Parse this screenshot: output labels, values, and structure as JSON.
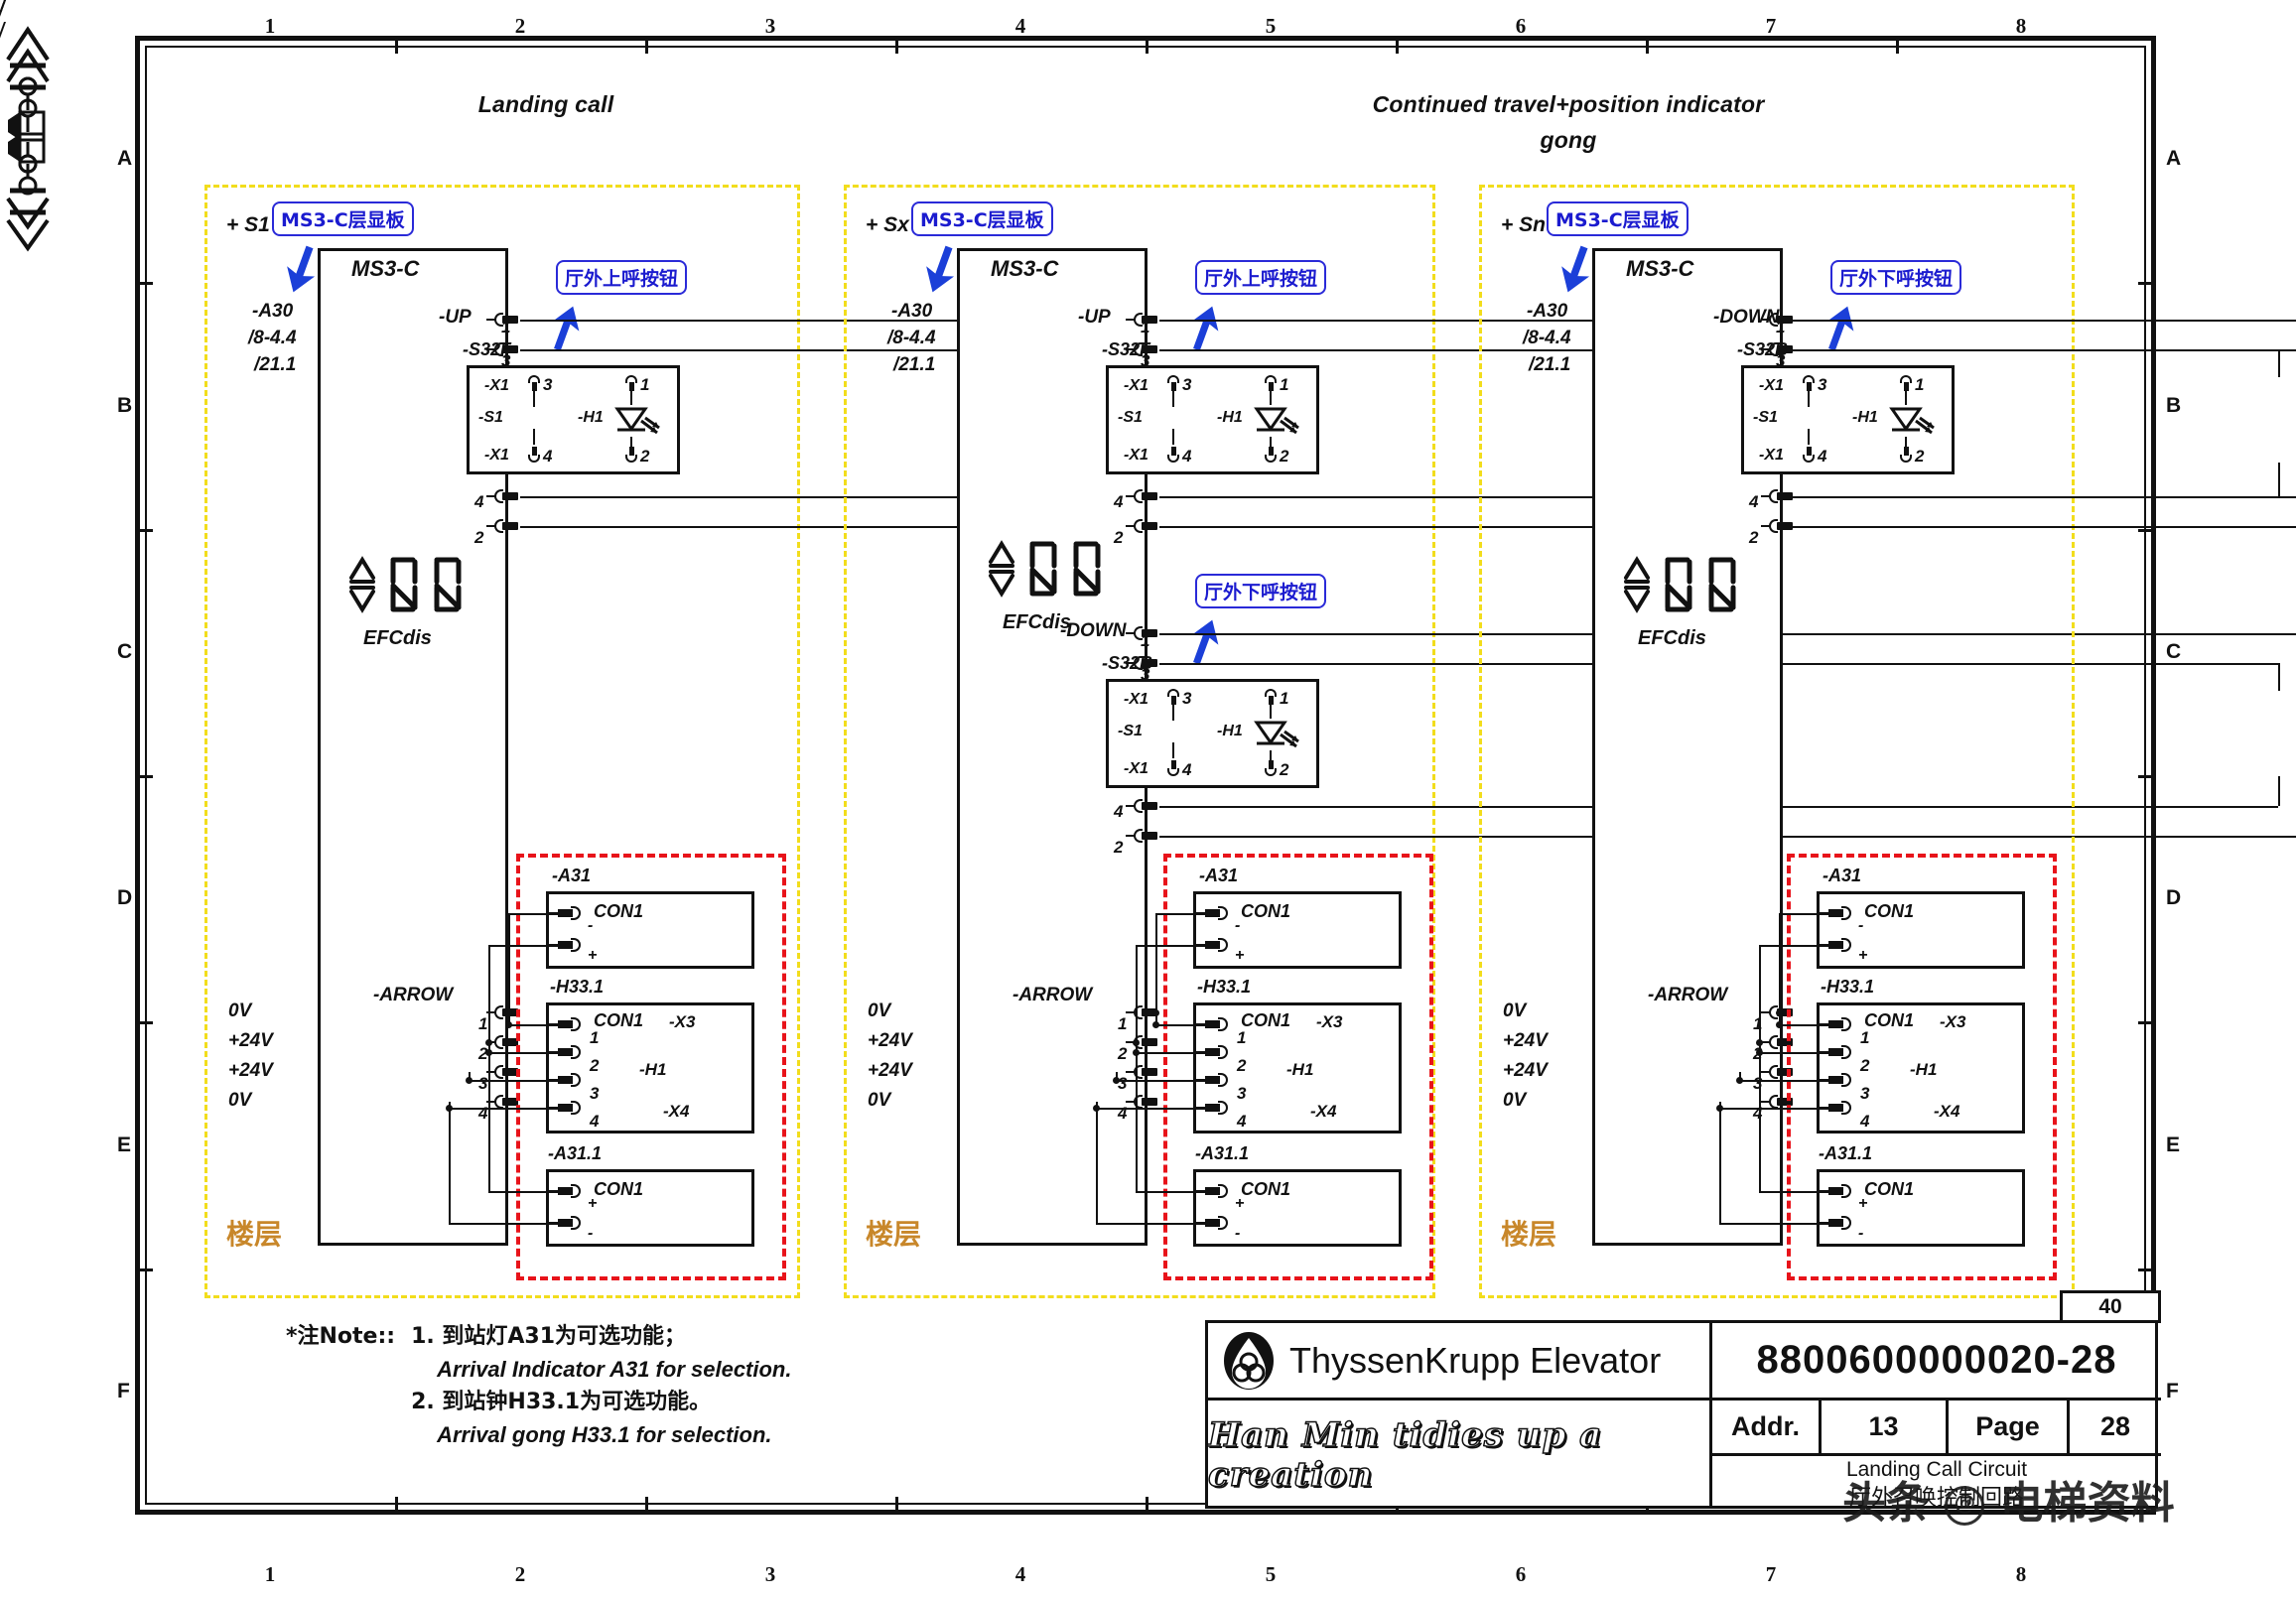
{
  "sheet": {
    "col_numbers": [
      "1",
      "2",
      "3",
      "4",
      "5",
      "6",
      "7",
      "8"
    ],
    "row_letters": [
      "A",
      "B",
      "C",
      "D",
      "E",
      "F"
    ],
    "heading_left": "Landing call",
    "heading_right_line1": "Continued travel+position indicator",
    "heading_right_line2": "gong"
  },
  "callouts": {
    "board": "MS3-C层显板",
    "btn_up": "厅外上呼按钮",
    "btn_down": "厅外下呼按钮"
  },
  "labels": {
    "floor": "楼层",
    "ms3c": "MS3-C",
    "a30": "-A30",
    "ref1": "/8-4.4",
    "ref2": "/21.1",
    "up": "-UP",
    "down": "-DOWN",
    "efcdis": "EFCdis",
    "arrow": "-ARROW",
    "s32f": "-S32F",
    "s32b": "-S32B",
    "x1": "-X1",
    "s1": "-S1",
    "h1": "-H1",
    "a31": "-A31",
    "a31_1": "-A31.1",
    "h33_1": "-H33.1",
    "con1": "CON1",
    "x3": "-X3",
    "x4": "-X4",
    "plus": "+",
    "minus": "-",
    "n1": "1",
    "n2": "2",
    "n3": "3",
    "n4": "4",
    "v0": "0V",
    "v24": "+24V"
  },
  "panels": [
    {
      "id": "left",
      "plus_label": "+ S1",
      "call_dir": "-UP",
      "switch": "-S32F"
    },
    {
      "id": "middle",
      "plus_label": "+ Sx",
      "call_dir": "-UP",
      "switch": "-S32F"
    },
    {
      "id": "right",
      "plus_label": "+ Sn",
      "call_dir": "-DOWN",
      "switch": "-S32B"
    }
  ],
  "notes": {
    "prefix": "*注Note::",
    "item1_cn": "1. 到站灯A31为可选功能；",
    "item1_en": "Arrival Indicator A31 for selection.",
    "item2_cn": "2. 到站钟H33.1为可选功能。",
    "item2_en": "Arrival gong H33.1 for selection."
  },
  "title_block": {
    "company": "ThyssenKrupp Elevator",
    "signature": "Han Min tidies up a creation",
    "drawing_number": "8800600000020-28",
    "revision": "40",
    "addr_label": "Addr.",
    "addr_value": "13",
    "page_label": "Page",
    "page_value": "28",
    "circuit_title_en": "Landing Call Circuit",
    "circuit_title_cn": "厅外召唤控制回路"
  },
  "watermark": {
    "prefix": "头条",
    "badge": "@",
    "suffix": "电梯资料"
  },
  "colors": {
    "yellow_panel": "#f2dd1c",
    "red_panel": "#e8131a",
    "blue_callout": "#1b1bcf",
    "floor_orange": "#c8872a",
    "ink": "#111111"
  }
}
